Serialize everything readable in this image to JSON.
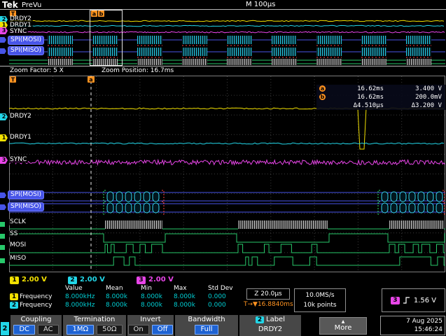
{
  "header": {
    "brand": "Tek",
    "status": "PreVu",
    "timebase": "M 100μs"
  },
  "overview": {
    "labels": [
      "DRDY2",
      "DRDY1",
      "SYNC",
      "SPI(MOSI)",
      "SPI(MISO)"
    ],
    "cursor_a": "a",
    "cursor_b": "b",
    "trigger_tab": "T"
  },
  "zoom": {
    "factor": "Zoom Factor: 5 X",
    "position": "Zoom Position: 16.7ms"
  },
  "main": {
    "labels": [
      "DRDY2",
      "DRDY1",
      "SYNC",
      "SPI(MOSI)",
      "SPI(MISO)",
      "SCLK",
      "SS",
      "MOSI",
      "MISO"
    ],
    "channel_tags": [
      "2",
      "1",
      "3"
    ],
    "cursor_a_tab": "a",
    "trigger_tab": "T"
  },
  "readout": {
    "a": {
      "icon": "a",
      "time": "16.62ms",
      "value": "3.400 V"
    },
    "b": {
      "icon": "b",
      "time": "16.62ms",
      "value": "200.0mV"
    },
    "delta": {
      "time": "Δ4.510μs",
      "value": "Δ3.200 V"
    }
  },
  "scales": [
    {
      "ch": "1",
      "value": "2.00 V"
    },
    {
      "ch": "2",
      "value": "2.00 V"
    },
    {
      "ch": "3",
      "value": "2.00 V"
    }
  ],
  "measurements": {
    "headers": [
      "Value",
      "Mean",
      "Min",
      "Max",
      "Std Dev"
    ],
    "rows": [
      {
        "ch": "1",
        "name": "Frequency",
        "value": "8.000kHz",
        "mean": "8.000k",
        "min": "8.000k",
        "max": "8.000k",
        "std": "0.000"
      },
      {
        "ch": "2",
        "name": "Frequency",
        "value": "8.000kHz",
        "mean": "8.000k",
        "min": "8.000k",
        "max": "8.000k",
        "std": "0.000"
      }
    ]
  },
  "horizontal": {
    "zoom_scale": "Z 20.0μs",
    "trig_readout": "T→▼16.8840ms",
    "sample_rate": "10.0MS/s",
    "record_length": "10k points"
  },
  "trigger": {
    "ch": "3",
    "level": "1.56 V"
  },
  "menu": {
    "coupling": {
      "title": "Coupling",
      "dc": "DC",
      "ac": "AC"
    },
    "termination": {
      "title": "Termination",
      "opt1": "1MΩ",
      "opt2": "50Ω"
    },
    "invert": {
      "title": "Invert",
      "on": "On",
      "off": "Off"
    },
    "bandwidth": {
      "title": "Bandwidth",
      "value": "Full"
    },
    "label": {
      "ch": "2",
      "title": "Label",
      "value": "DRDY2"
    },
    "more": "More",
    "date": "7 Aug 2025",
    "time": "15:46:24",
    "active_channel": "2"
  },
  "icons": {
    "more_arrow": "▲"
  },
  "colors": {
    "ch1": "#f2e000",
    "ch2": "#22d6e8",
    "ch3": "#e845e8",
    "bus": "#4754e8",
    "digital": "#27c96a",
    "accent_orange": "#ff9320",
    "selected_blue": "#1e62d2",
    "measure_value": "#00cfd4",
    "red_mark": "#ff4040"
  }
}
